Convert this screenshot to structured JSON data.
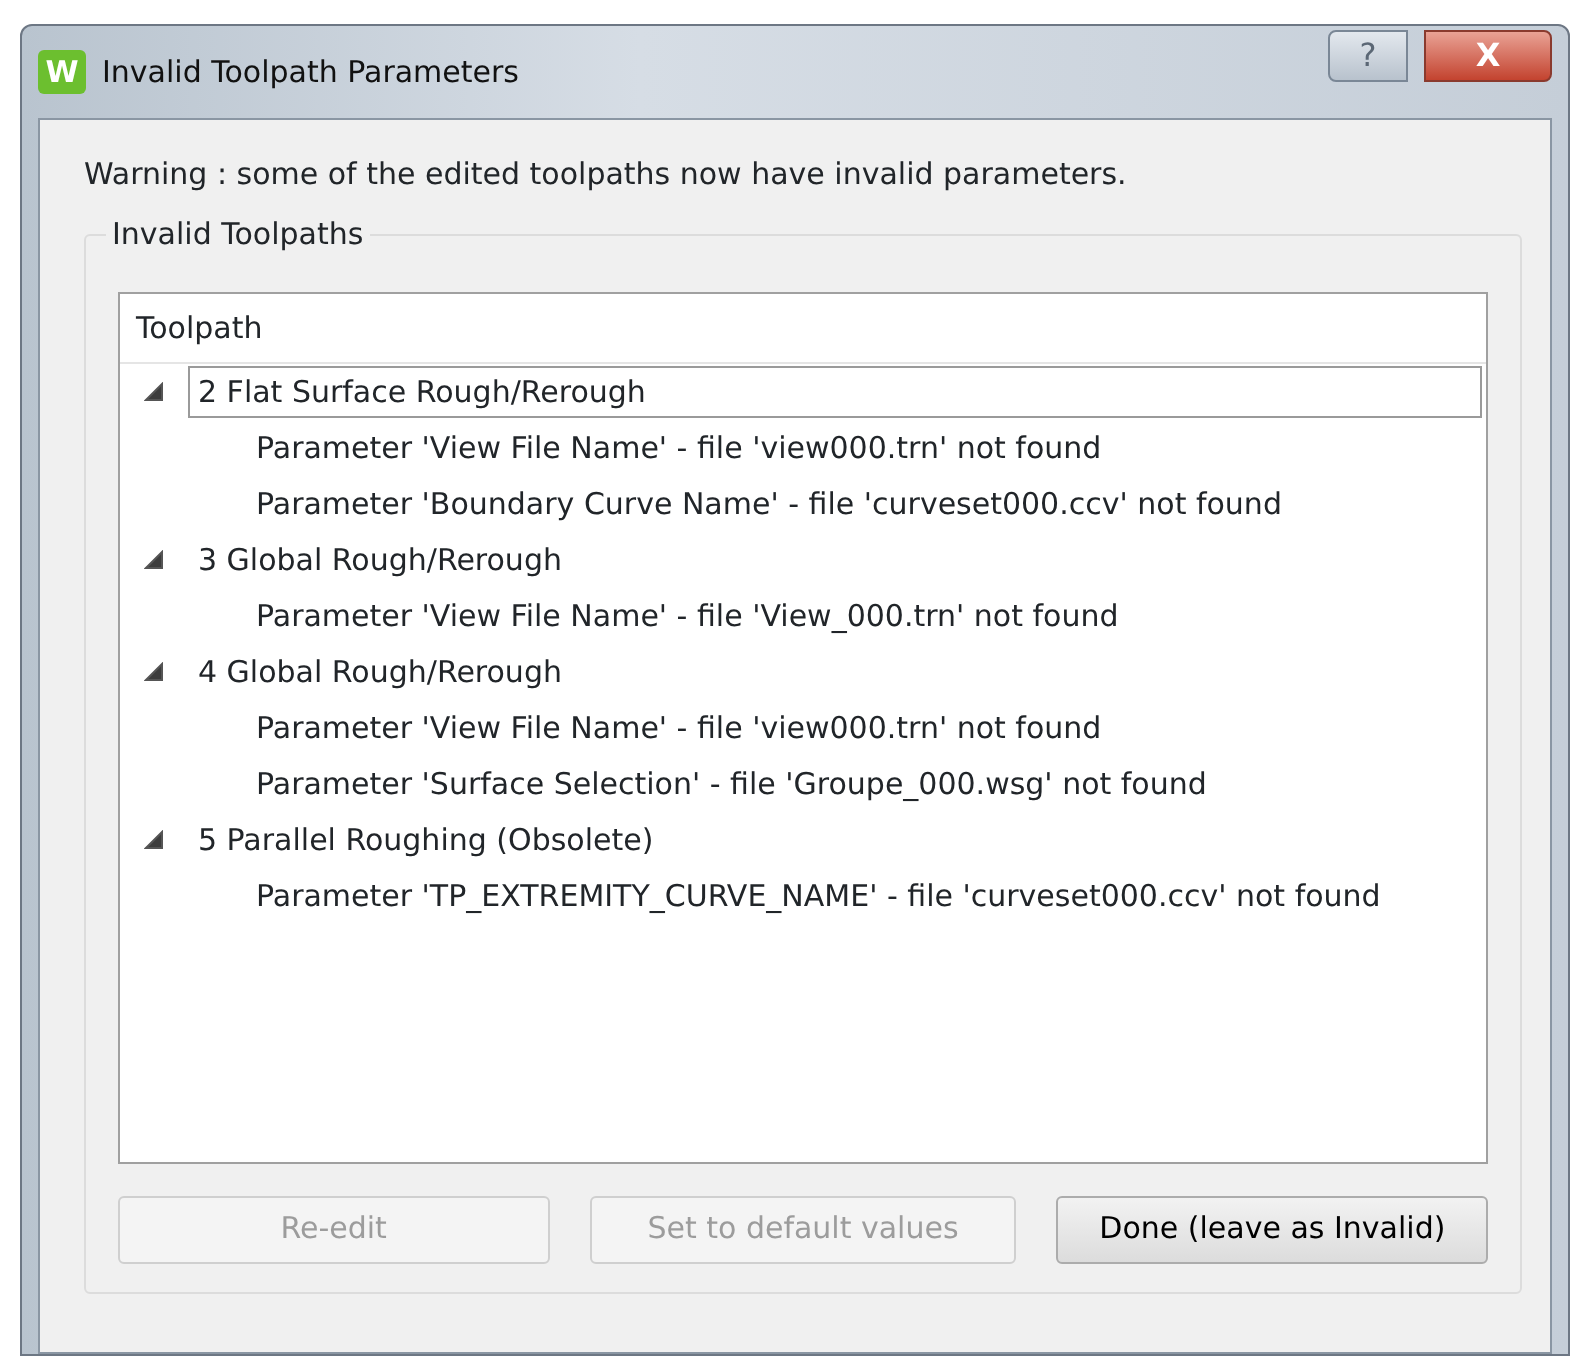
{
  "window": {
    "title": "Invalid Toolpath Parameters",
    "app_icon_letter": "W",
    "help_button": "?",
    "close_button": "X"
  },
  "message": "Warning : some of the edited toolpaths now have invalid parameters.",
  "group": {
    "title": "Invalid Toolpaths"
  },
  "tree": {
    "column": "Toolpath",
    "items": [
      {
        "label": "2 Flat Surface Rough/Rerough",
        "expanded": true,
        "selected": true,
        "children": [
          {
            "label": "Parameter 'View File Name' - file 'view000.trn' not found"
          },
          {
            "label": "Parameter 'Boundary Curve Name' - file 'curveset000.ccv' not found"
          }
        ]
      },
      {
        "label": "3 Global Rough/Rerough",
        "expanded": true,
        "selected": false,
        "children": [
          {
            "label": "Parameter 'View File Name' - file 'View_000.trn' not found"
          }
        ]
      },
      {
        "label": "4 Global Rough/Rerough",
        "expanded": true,
        "selected": false,
        "children": [
          {
            "label": "Parameter 'View File Name' - file 'view000.trn' not found"
          },
          {
            "label": "Parameter 'Surface Selection' - file 'Groupe_000.wsg' not found"
          }
        ]
      },
      {
        "label": "5 Parallel Roughing (Obsolete)",
        "expanded": true,
        "selected": false,
        "children": [
          {
            "label": "Parameter 'TP_EXTREMITY_CURVE_NAME' - file 'curveset000.ccv' not found"
          }
        ]
      }
    ]
  },
  "buttons": [
    {
      "label": "Re-edit",
      "disabled": true
    },
    {
      "label": "Set to default values",
      "disabled": true
    },
    {
      "label": "Done (leave as Invalid)",
      "disabled": false
    }
  ]
}
